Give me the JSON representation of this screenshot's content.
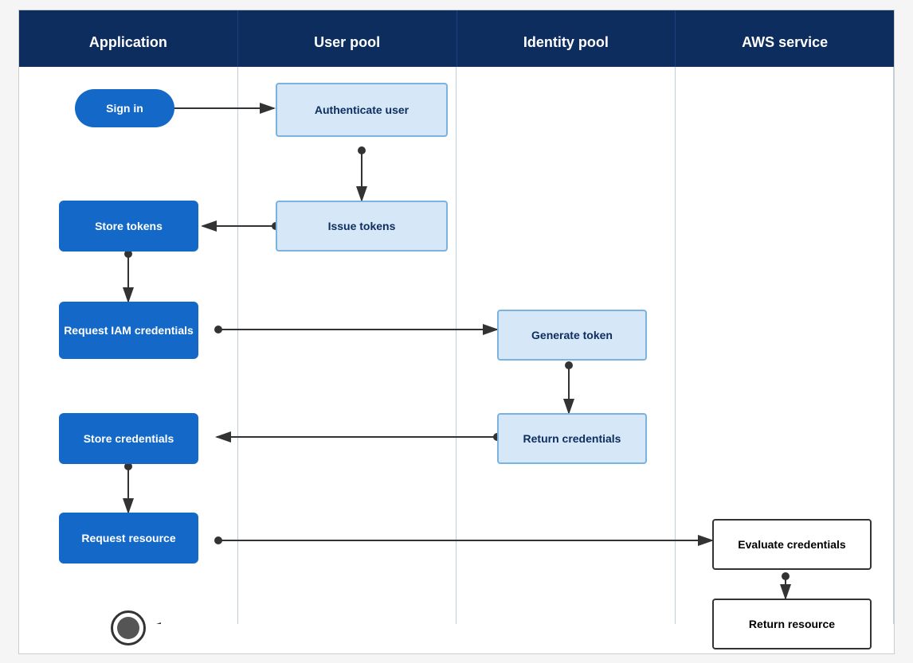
{
  "columns": [
    {
      "id": "application",
      "label": "Application"
    },
    {
      "id": "user-pool",
      "label": "User pool"
    },
    {
      "id": "identity-pool",
      "label": "Identity pool"
    },
    {
      "id": "aws-service",
      "label": "AWS service"
    }
  ],
  "nodes": {
    "sign_in": {
      "label": "Sign in",
      "type": "oval"
    },
    "authenticate_user": {
      "label": "Authenticate user",
      "type": "light"
    },
    "issue_tokens": {
      "label": "Issue tokens",
      "type": "light"
    },
    "store_tokens": {
      "label": "Store tokens",
      "type": "blue"
    },
    "request_iam": {
      "label": "Request IAM credentials",
      "type": "blue"
    },
    "generate_token": {
      "label": "Generate token",
      "type": "light"
    },
    "return_credentials": {
      "label": "Return credentials",
      "type": "light"
    },
    "store_credentials": {
      "label": "Store credentials",
      "type": "blue"
    },
    "request_resource": {
      "label": "Request resource",
      "type": "blue"
    },
    "evaluate_credentials": {
      "label": "Evaluate credentials",
      "type": "white"
    },
    "return_resource": {
      "label": "Return resource",
      "type": "white"
    },
    "end": {
      "label": "",
      "type": "end"
    }
  }
}
